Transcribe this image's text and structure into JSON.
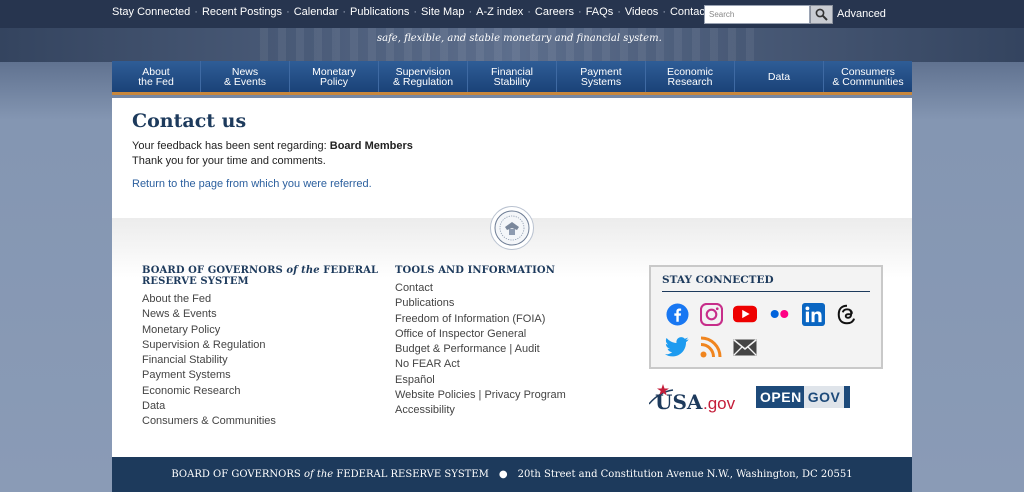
{
  "utility_nav": [
    "Stay Connected",
    "Recent Postings",
    "Calendar",
    "Publications",
    "Site Map",
    "A-Z index",
    "Careers",
    "FAQs",
    "Videos",
    "Contact"
  ],
  "search": {
    "placeholder": "Search",
    "advanced_label": "Advanced"
  },
  "tagline": "safe, flexible, and stable monetary and financial system.",
  "main_nav": [
    "About\nthe Fed",
    "News\n& Events",
    "Monetary\nPolicy",
    "Supervision\n& Regulation",
    "Financial\nStability",
    "Payment\nSystems",
    "Economic\nResearch",
    "Data",
    "Consumers\n& Communities"
  ],
  "content": {
    "title": "Contact us",
    "feedback_prefix": "Your feedback has been sent regarding: ",
    "feedback_subject": "Board Members",
    "thanks": "Thank you for your time and comments.",
    "return_link": "Return to the page from which you were referred."
  },
  "footer": {
    "col1_head_a": "BOARD OF GOVERNORS ",
    "col1_head_of": "of the",
    "col1_head_b": " FEDERAL",
    "col1_head_c": "RESERVE SYSTEM",
    "col1_links": [
      "About the Fed",
      "News & Events",
      "Monetary Policy",
      "Supervision & Regulation",
      "Financial Stability",
      "Payment Systems",
      "Economic Research",
      "Data",
      "Consumers & Communities"
    ],
    "col2_head": "TOOLS AND INFORMATION",
    "col2_links": [
      "Contact",
      "Publications",
      "Freedom of Information (FOIA)",
      "Office of Inspector General",
      "Budget & Performance | Audit",
      "No FEAR Act",
      "Español",
      "Website Policies | Privacy Program",
      "Accessibility"
    ],
    "stay_connected": "STAY CONNECTED",
    "usagov": {
      "usa": "USA",
      "gov": ".gov"
    },
    "opengov": {
      "a": "OPEN",
      "b": "GOV"
    }
  },
  "bottom_bar": {
    "a": "BOARD OF GOVERNORS ",
    "of": "of the",
    "b": " FEDERAL RESERVE SYSTEM",
    "address": "20th Street and Constitution Avenue N.W., Washington, DC 20551"
  },
  "colors": {
    "navy": "#1d3a5c",
    "nav_blue": "#1a4278",
    "accent_orange": "#c8873c",
    "link_blue": "#2b5f9e"
  }
}
